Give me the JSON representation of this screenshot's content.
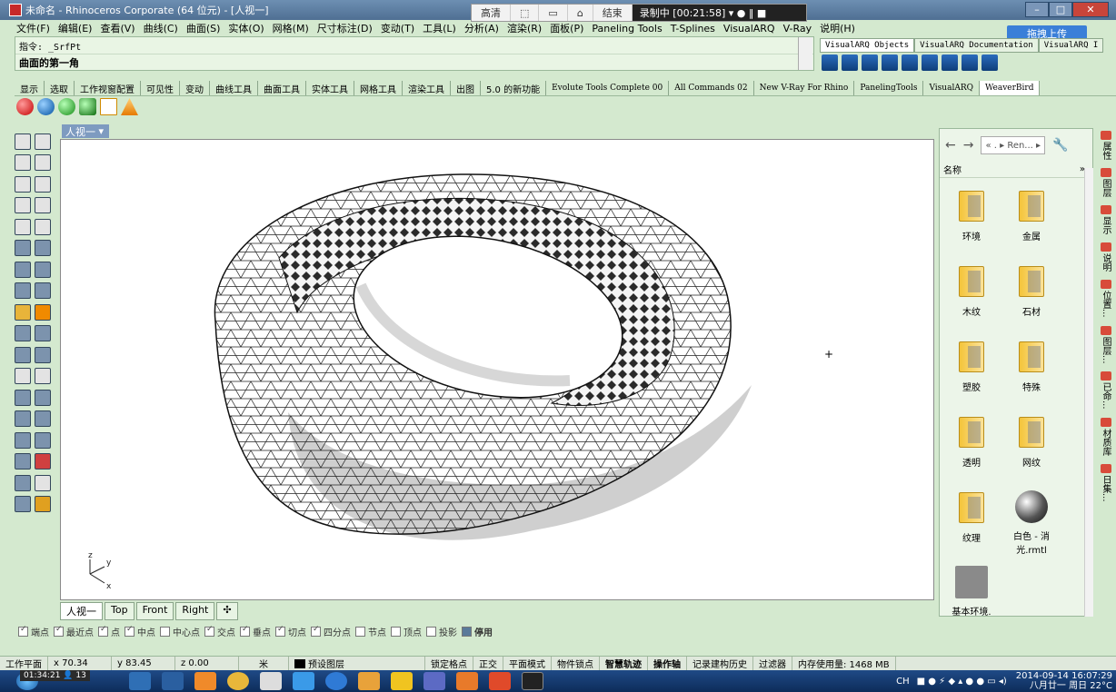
{
  "window": {
    "title": "未命名 - Rhinoceros Corporate (64 位元) - [人视一]",
    "controls": {
      "minimize": "–",
      "maximize": "□",
      "close": "✕"
    }
  },
  "recorder": {
    "quality": "高清",
    "end_label": "结束",
    "status": "录制中 [00:21:58]"
  },
  "upload_button": "拖拽上传",
  "menu": [
    "文件(F)",
    "编辑(E)",
    "查看(V)",
    "曲线(C)",
    "曲面(S)",
    "实体(O)",
    "网格(M)",
    "尺寸标注(D)",
    "变动(T)",
    "工具(L)",
    "分析(A)",
    "渲染(R)",
    "面板(P)",
    "Paneling Tools",
    "T-Splines",
    "VisualARQ",
    "V-Ray",
    "说明(H)"
  ],
  "command": {
    "history": "指令: _SrfPt",
    "prompt": "曲面的第一角"
  },
  "plugin_tabs": [
    "VisualARQ Objects",
    "VisualARQ Documentation",
    "VisualARQ I"
  ],
  "toolbar_tabs": [
    "显示",
    "选取",
    "工作视窗配置",
    "可见性",
    "变动",
    "曲线工具",
    "曲面工具",
    "实体工具",
    "网格工具",
    "渲染工具",
    "出图",
    "5.0 的新功能",
    "Evolute Tools Complete 00",
    "All Commands 02",
    "New V-Ray For Rhino",
    "PanelingTools",
    "VisualARQ",
    "WeaverBird"
  ],
  "viewport": {
    "title": "人视一",
    "axis": {
      "z": "z",
      "y": "y",
      "x": "x"
    }
  },
  "viewport_tabs": [
    "人视一",
    "Top",
    "Front",
    "Right",
    "✣"
  ],
  "osnaps": [
    {
      "label": "端点",
      "checked": true
    },
    {
      "label": "最近点",
      "checked": true
    },
    {
      "label": "点",
      "checked": true
    },
    {
      "label": "中点",
      "checked": true
    },
    {
      "label": "中心点",
      "checked": false
    },
    {
      "label": "交点",
      "checked": true
    },
    {
      "label": "垂点",
      "checked": true
    },
    {
      "label": "切点",
      "checked": true
    },
    {
      "label": "四分点",
      "checked": true
    },
    {
      "label": "节点",
      "checked": false
    },
    {
      "label": "顶点",
      "checked": false
    },
    {
      "label": "投影",
      "checked": false
    },
    {
      "label": "停用",
      "checked": false
    }
  ],
  "status": {
    "cplane": "工作平面",
    "x": "x 70.34",
    "y": "y 83.45",
    "z": "z 0.00",
    "unit": "米",
    "layer": "预设图层",
    "items": [
      "锁定格点",
      "正交",
      "平面模式",
      "物件锁点",
      "智慧轨迹",
      "操作轴",
      "记录建构历史",
      "过滤器"
    ],
    "memory": "内存使用量: 1468 MB"
  },
  "panel": {
    "path": "« . ▸ Ren... ▸",
    "column_header": "名称",
    "items": [
      {
        "label": "环境",
        "type": "folder"
      },
      {
        "label": "金属",
        "type": "folder"
      },
      {
        "label": "木纹",
        "type": "folder"
      },
      {
        "label": "石材",
        "type": "folder"
      },
      {
        "label": "塑胶",
        "type": "folder"
      },
      {
        "label": "特殊",
        "type": "folder"
      },
      {
        "label": "透明",
        "type": "folder"
      },
      {
        "label": "网纹",
        "type": "folder"
      },
      {
        "label": "纹理",
        "type": "folder"
      },
      {
        "label": "白色 - 消光.rmtl",
        "type": "material"
      },
      {
        "label": "基本环境.",
        "type": "environment"
      }
    ]
  },
  "side_tabs": [
    "属性",
    "图层",
    "显示",
    "说明",
    "位置...",
    "图层...",
    "已命...",
    "材质库",
    "日集..."
  ],
  "taskbar": {
    "recording_info": "01:34:21 👤 13",
    "lang": "CH",
    "time": "2014-09-14  16:07:29",
    "date": "八月廿一 周日 22°C"
  },
  "colors": {
    "background": "#d4e9cf",
    "accent": "#3a7fd8",
    "titlebar": "#4f6f93"
  }
}
